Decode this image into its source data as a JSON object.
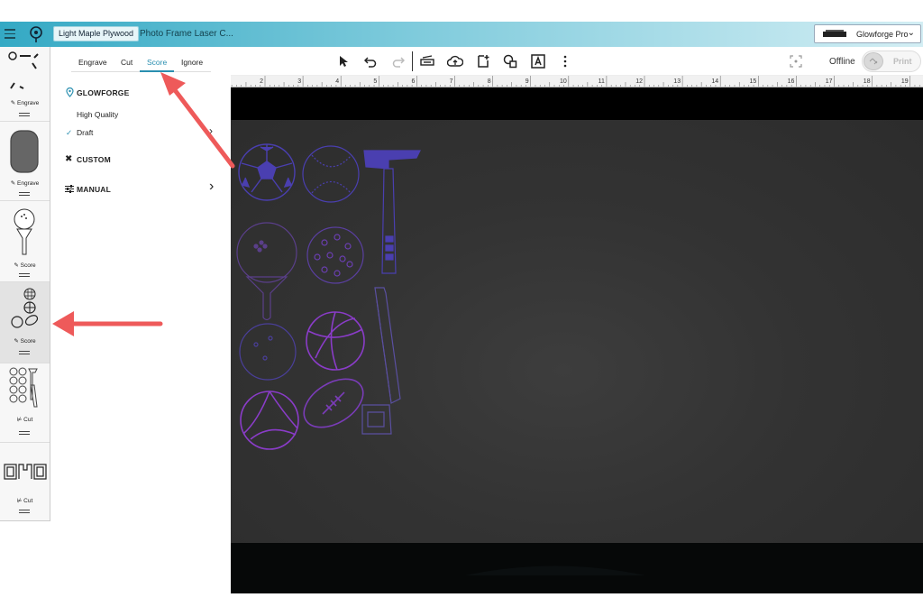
{
  "topbar": {
    "material": "Light Maple Plywood",
    "document_title": "Photo Frame Laser C...",
    "machine": "Glowforge Pro"
  },
  "toolbar": {
    "status": "Offline",
    "print_label": "Print",
    "icons": [
      "select-icon",
      "undo-icon",
      "redo-icon",
      "scan-icon",
      "cloud-upload-icon",
      "add-artwork-icon",
      "shapes-icon",
      "text-icon",
      "more-icon",
      "focus-icon"
    ]
  },
  "ruler": {
    "labels": [
      "2",
      "3",
      "4",
      "5",
      "6",
      "7",
      "8",
      "9",
      "10",
      "11",
      "12",
      "13",
      "14",
      "15",
      "16",
      "17",
      "18",
      "19"
    ]
  },
  "thumbnails": [
    {
      "operation": "Engrave"
    },
    {
      "operation": "Engrave"
    },
    {
      "operation": "Score"
    },
    {
      "operation": "Score"
    },
    {
      "operation": "Cut"
    },
    {
      "operation": "Cut"
    }
  ],
  "panel": {
    "tabs": [
      "Engrave",
      "Cut",
      "Score",
      "Ignore"
    ],
    "active_tab": "Score",
    "sections": {
      "glowforge": "GLOWFORGE",
      "high_quality": "High Quality",
      "draft": "Draft",
      "custom": "CUSTOM",
      "manual": "MANUAL"
    }
  },
  "colors": {
    "accent": "#2a8fb0",
    "annotation_arrow": "#ee5a5a",
    "design_blue": "#4a3fb0",
    "design_purple": "#8a3cc8"
  }
}
